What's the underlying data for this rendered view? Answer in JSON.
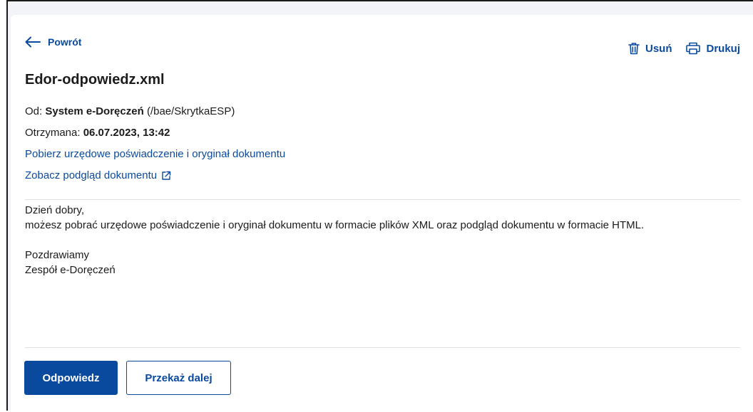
{
  "nav": {
    "back_label": "Powrót"
  },
  "toolbar": {
    "delete_label": "Usuń",
    "print_label": "Drukuj"
  },
  "message": {
    "title": "Edor-odpowiedz.xml",
    "from_label": "Od:",
    "from_name": "System e-Doręczeń",
    "from_address": "(/bae/SkrytkaESP)",
    "received_label": "Otrzymana:",
    "received_value": "06.07.2023, 13:42",
    "download_link": "Pobierz urzędowe poświadczenie i oryginał dokumentu",
    "preview_link": "Zobacz podgląd dokumentu",
    "body": {
      "greeting": "Dzień dobry,",
      "text": "możesz pobrać urzędowe poświadczenie i oryginał dokumentu w formacie plików XML oraz podgląd dokumentu w formacie HTML.",
      "closing": "Pozdrawiamy",
      "signature": "Zespół e-Doręczeń"
    }
  },
  "buttons": {
    "reply_label": "Odpowiedz",
    "forward_label": "Przekaż dalej"
  },
  "colors": {
    "accent": "#0a4a9e",
    "text": "#1b1b1b",
    "divider": "#dcdfe4",
    "page_bg": "#f2f4f7"
  },
  "icons": {
    "back": "arrow-left-icon",
    "delete": "trash-icon",
    "print": "printer-icon",
    "external": "external-link-icon"
  }
}
